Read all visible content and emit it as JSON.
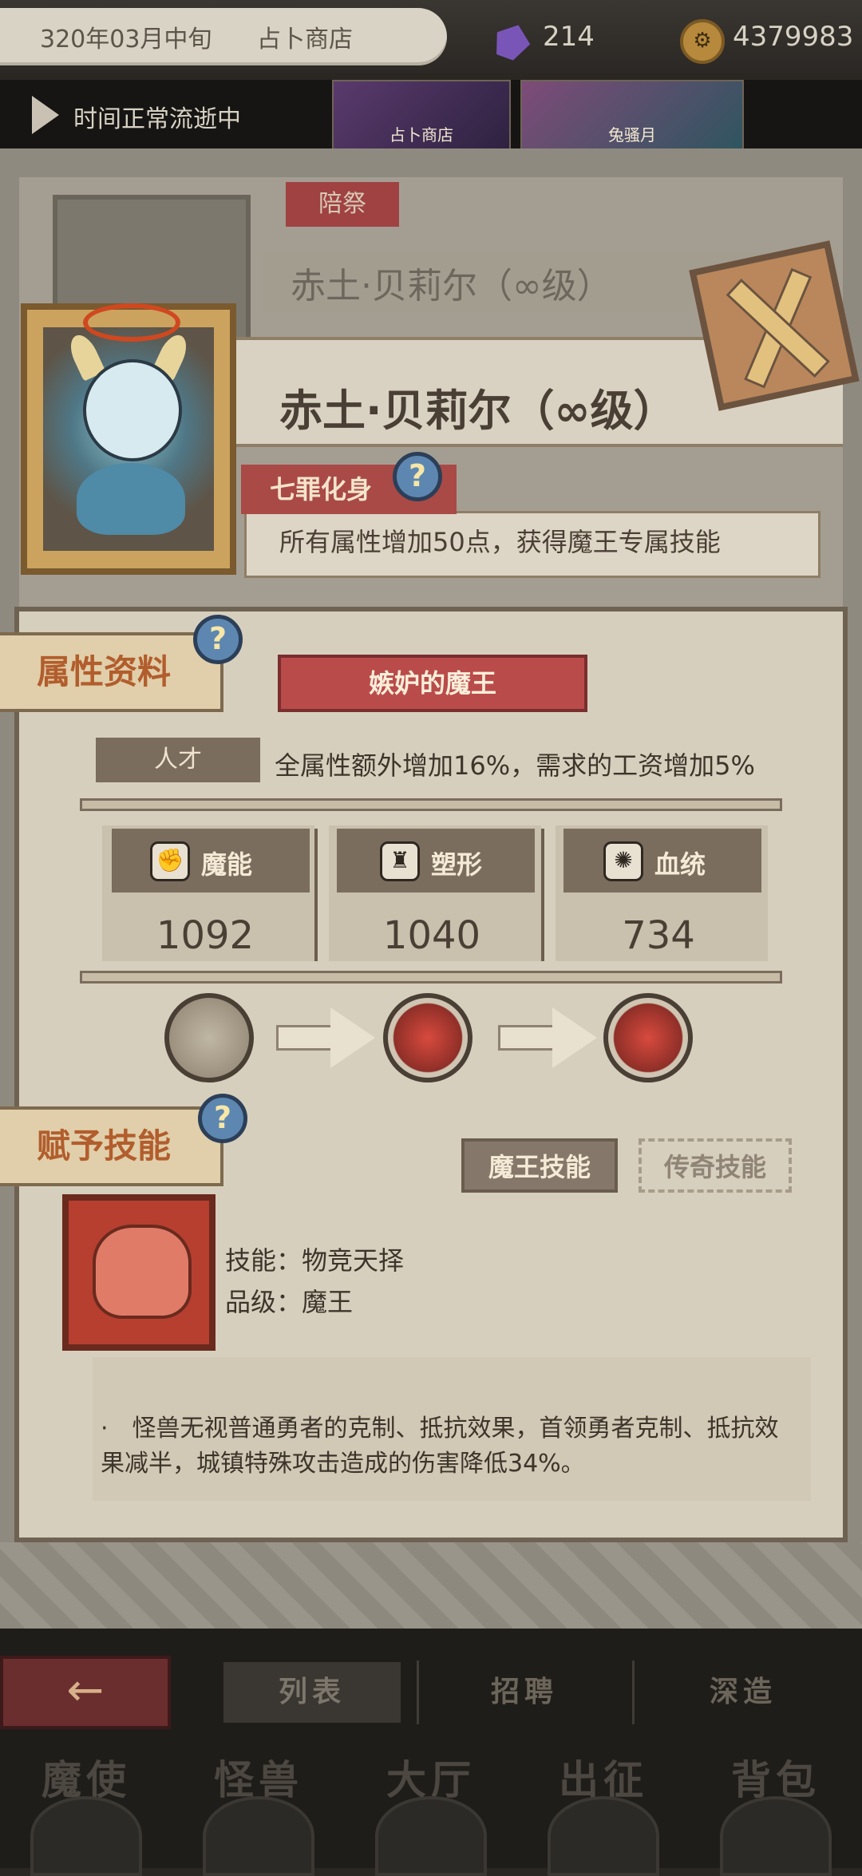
{
  "topbar": {
    "date": "320年03月中旬",
    "location": "占卜商店",
    "gems": "214",
    "coins": "4379983"
  },
  "timebar": {
    "status": "时间正常流逝中",
    "events": [
      "占卜商店",
      "兔骚月"
    ]
  },
  "back_card": {
    "tag": "陪祭",
    "name": "赤土·贝莉尔（∞级）"
  },
  "hero": {
    "name": "赤土·贝莉尔（∞级）",
    "trait_tag": "七罪化身",
    "trait_desc": "所有属性增加50点，获得魔王专属技能"
  },
  "attributes": {
    "section_title": "属性资料",
    "title_banner": "嫉妒的魔王",
    "talent_tag": "人才",
    "talent_desc": "全属性额外增加16%，需求的工资增加5%",
    "stats": [
      {
        "label": "魔能",
        "value": "1092",
        "icon": "magic-fist-icon"
      },
      {
        "label": "塑形",
        "value": "1040",
        "icon": "body-armor-icon"
      },
      {
        "label": "血统",
        "value": "734",
        "icon": "gear-orb-icon"
      }
    ]
  },
  "skills": {
    "section_title": "赋予技能",
    "tab_active": "魔王技能",
    "tab_inactive": "传奇技能",
    "skill_name": "技能：物竞天择",
    "skill_grade": "品级：魔王",
    "description": "·　怪兽无视普通勇者的克制、抵抗效果，首领勇者克制、抵抗效果减半，城镇特殊攻击造成的伤害降低34%。"
  },
  "bottom": {
    "back_arrow": "←",
    "subtabs": [
      "列表",
      "招聘",
      "深造"
    ],
    "main_tabs": [
      "魔使",
      "怪兽",
      "大厅",
      "出征",
      "背包"
    ]
  },
  "question_mark": "?",
  "colors": {
    "accent_red": "#b94c4a",
    "section_orange": "#b25d2d",
    "parchment": "#d7cfbd"
  }
}
